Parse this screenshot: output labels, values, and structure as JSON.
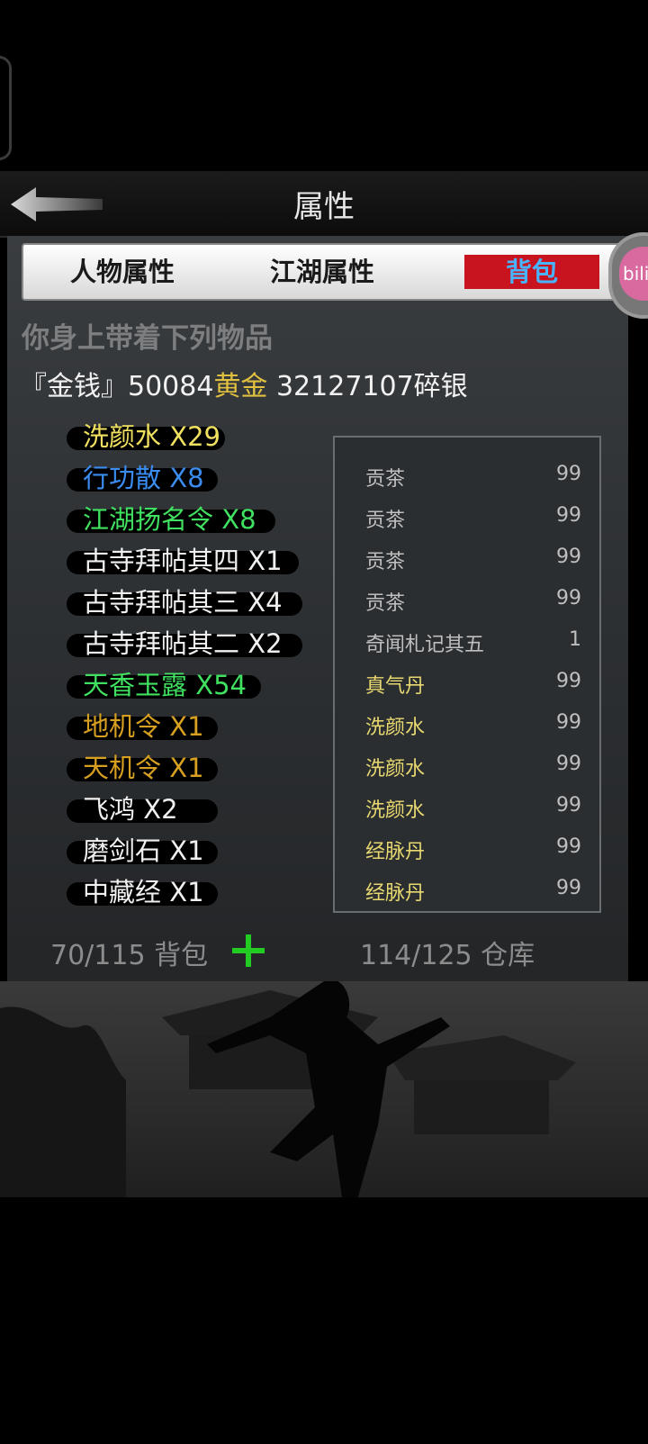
{
  "header": {
    "title": "属性"
  },
  "tabs": [
    {
      "label": "人物属性"
    },
    {
      "label": "江湖属性"
    },
    {
      "label": "背包"
    }
  ],
  "overlay": {
    "bili_label": "bili"
  },
  "inventory": {
    "subtitle": "你身上带着下列物品",
    "money_prefix": "『金钱』50084",
    "money_gold": "黄金",
    "money_silver": " 32127107碎银",
    "items": [
      {
        "name": "洗颜水 X29",
        "color": "yellow"
      },
      {
        "name": "行功散 X8",
        "color": "blue"
      },
      {
        "name": "江湖扬名令 X8",
        "color": "green"
      },
      {
        "name": "古寺拜帖其四 X1",
        "color": "white"
      },
      {
        "name": "古寺拜帖其三 X4",
        "color": "white"
      },
      {
        "name": "古寺拜帖其二 X2",
        "color": "white"
      },
      {
        "name": "天香玉露 X54",
        "color": "green"
      },
      {
        "name": "地机令 X1",
        "color": "orange"
      },
      {
        "name": "天机令 X1",
        "color": "orange"
      },
      {
        "name": "飞鸿 X2",
        "color": "white"
      },
      {
        "name": "磨剑石 X1",
        "color": "white"
      },
      {
        "name": "中藏经 X1",
        "color": "white"
      }
    ]
  },
  "storage_list": [
    {
      "name": "贡茶",
      "count": "99",
      "color": "#bfbfbf"
    },
    {
      "name": "贡茶",
      "count": "99",
      "color": "#bfbfbf"
    },
    {
      "name": "贡茶",
      "count": "99",
      "color": "#bfbfbf"
    },
    {
      "name": "贡茶",
      "count": "99",
      "color": "#bfbfbf"
    },
    {
      "name": "奇闻札记其五",
      "count": "1",
      "color": "#bfbfbf"
    },
    {
      "name": "真气丹",
      "count": "99",
      "color": "#e8d870"
    },
    {
      "name": "洗颜水",
      "count": "99",
      "color": "#e8d870"
    },
    {
      "name": "洗颜水",
      "count": "99",
      "color": "#e8d870"
    },
    {
      "name": "洗颜水",
      "count": "99",
      "color": "#e8d870"
    },
    {
      "name": "经脉丹",
      "count": "99",
      "color": "#e8d870"
    },
    {
      "name": "经脉丹",
      "count": "99",
      "color": "#e8d870"
    }
  ],
  "footer": {
    "bag_label": "70/115 背包",
    "warehouse_label": "114/125 仓库"
  }
}
